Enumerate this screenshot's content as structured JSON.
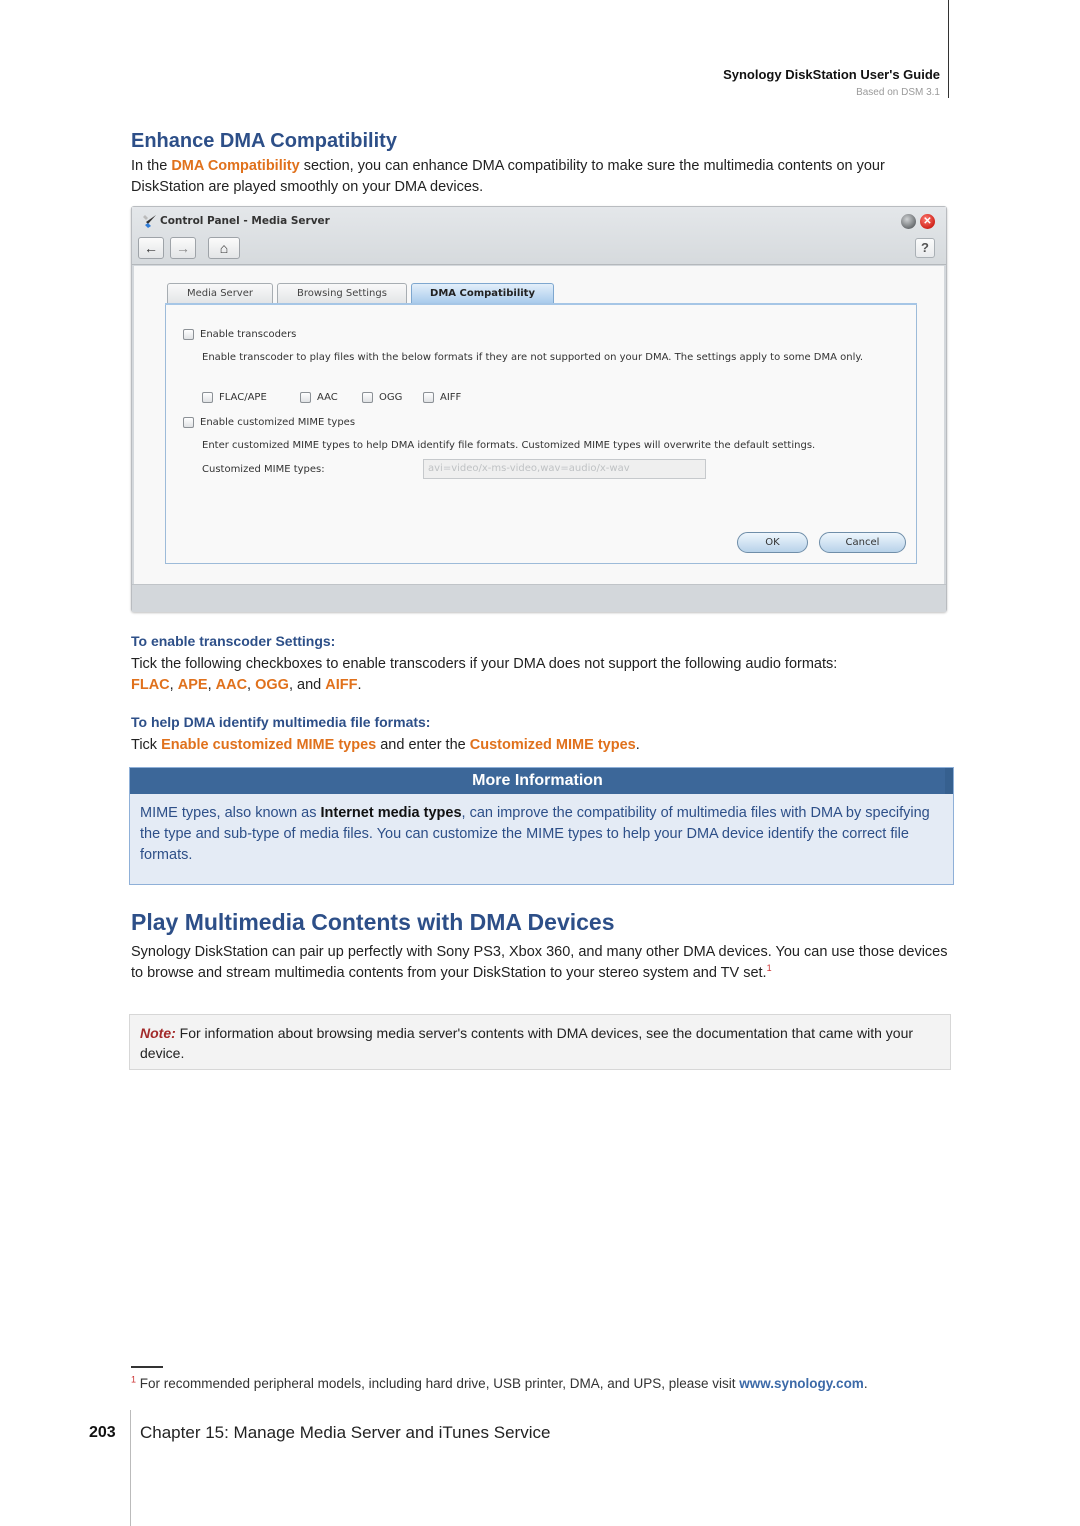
{
  "header": {
    "guide_title": "Synology DiskStation User's Guide",
    "guide_subtitle": "Based on DSM 3.1"
  },
  "section_enhance": {
    "title": "Enhance DMA Compatibility",
    "intro_before": "In the ",
    "intro_highlight": "DMA Compatibility",
    "intro_after": " section, you can enhance DMA compatibility to make sure the multimedia contents on your DiskStation are played smoothly on your DMA devices."
  },
  "window": {
    "title": "Control Panel - Media Server",
    "icons": {
      "logo": "control-panel-icon",
      "back": "←",
      "forward": "→",
      "home": "⌂",
      "minimize": "minimize-icon",
      "close": "✕",
      "help": "?"
    },
    "tabs": [
      {
        "label": "Media Server",
        "active": false
      },
      {
        "label": "Browsing Settings",
        "active": false
      },
      {
        "label": "DMA Compatibility",
        "active": true
      }
    ],
    "enable_transcoders": {
      "label": "Enable transcoders",
      "checked": false
    },
    "transcoder_desc": "Enable transcoder to play files with the below formats if they are not supported on your DMA. The settings apply to some DMA only.",
    "formats": [
      {
        "label": "FLAC/APE",
        "checked": false
      },
      {
        "label": "AAC",
        "checked": false
      },
      {
        "label": "OGG",
        "checked": false
      },
      {
        "label": "AIFF",
        "checked": false
      }
    ],
    "enable_mime": {
      "label": "Enable customized MIME types",
      "checked": false
    },
    "mime_desc": "Enter customized MIME types to help DMA identify file formats. Customized MIME types will overwrite the default settings.",
    "mime_field_label": "Customized MIME types:",
    "mime_field_placeholder": "avi=video/x-ms-video,wav=audio/x-wav",
    "ok_label": "OK",
    "cancel_label": "Cancel"
  },
  "transcoder_settings": {
    "heading": "To enable transcoder Settings:",
    "text": "Tick the following checkboxes to enable transcoders if your DMA does not support the following audio formats:",
    "formats": [
      "FLAC",
      "APE",
      "AAC",
      "OGG",
      "AIFF"
    ],
    "sep1": ", ",
    "sep_and": ", and ",
    "end": "."
  },
  "mime_help": {
    "heading": "To help DMA identify multimedia file formats:",
    "text_before": "Tick ",
    "hl1": "Enable customized MIME types",
    "text_mid": " and enter the ",
    "hl2": "Customized MIME types",
    "text_end": "."
  },
  "more_info": {
    "heading": "More Information",
    "text_before": "MIME types, also known as ",
    "bold": "Internet media types",
    "text_after": ", can improve the compatibility of multimedia files with DMA by specifying the type and sub-type of media files. You can customize the MIME types to help your DMA device identify the correct file formats."
  },
  "section_play": {
    "title": "Play Multimedia Contents with DMA Devices",
    "text": "Synology DiskStation can pair up perfectly with Sony PS3, Xbox 360, and many other DMA devices. You can use those devices to browse and stream multimedia contents from your DiskStation to your stereo system and TV set.",
    "footnote_ref": "1"
  },
  "note": {
    "label": "Note:",
    "text": " For information about browsing media server's contents with DMA devices, see the documentation that came with your device."
  },
  "footnote": {
    "number": "1",
    "text": " For recommended peripheral models, including hard drive, USB printer, DMA, and UPS, please visit ",
    "link": "www.synology.com",
    "end": "."
  },
  "footer": {
    "page_number": "203",
    "chapter": "Chapter 15: Manage Media Server and iTunes Service"
  },
  "colors": {
    "heading_blue": "#2d4f88",
    "highlight_orange": "#e0711c",
    "info_header": "#3c6799",
    "note_red": "#a22a2a"
  }
}
